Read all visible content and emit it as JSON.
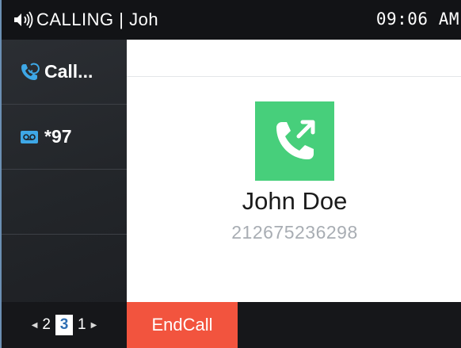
{
  "status_bar": {
    "title": "CALLING | Joh",
    "time": "09:06 AM"
  },
  "sidebar": {
    "items": [
      {
        "label": "Call...",
        "icon": "call-transfer-icon"
      },
      {
        "label": "*97",
        "icon": "voicemail-icon"
      }
    ]
  },
  "call": {
    "icon": "outgoing-call-icon",
    "name": "John Doe",
    "number": "212675236298"
  },
  "pager": {
    "prev": "2",
    "current": "3",
    "next": "1"
  },
  "softkeys": {
    "end_call": "EndCall"
  },
  "colors": {
    "accent_green": "#47cf7b",
    "end_call_red": "#f2543e",
    "icon_blue": "#3ea7e6"
  }
}
